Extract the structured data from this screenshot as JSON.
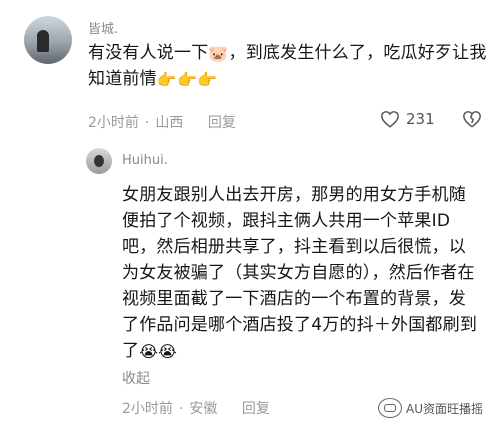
{
  "comment": {
    "username": "皆城.",
    "text_before_emoji": "有没有人说一下",
    "text_after_emoji": "，到底发生什么了，吃瓜好歹让我知道前情",
    "time": "2小时前",
    "location": "山西",
    "reply_label": "回复",
    "like_count": "231"
  },
  "reply": {
    "username": "Huihui.",
    "text": "女朋友跟别人出去开房，那男的用女方手机随便拍了个视频，跟抖主俩人共用一个苹果ID吧，然后相册共享了，抖主看到以后很慌，以为女友被骗了（其实女方自愿的），然后作者在视频里面截了一下酒店的一个布置的背景，发了作品问是哪个酒店投了4万的抖＋外国都刷到了",
    "collapse_label": "收起",
    "time": "2小时前",
    "location": "安徽",
    "reply_label": "回复"
  },
  "watermark": {
    "text": "AU资面旺播摇"
  },
  "icons": {
    "emoji_pig": "pig-face-icon",
    "emoji_point": "pointing-hand-icon",
    "emoji_cry": "crying-face-icon",
    "like": "heart-icon",
    "dislike": "broken-heart-icon"
  }
}
